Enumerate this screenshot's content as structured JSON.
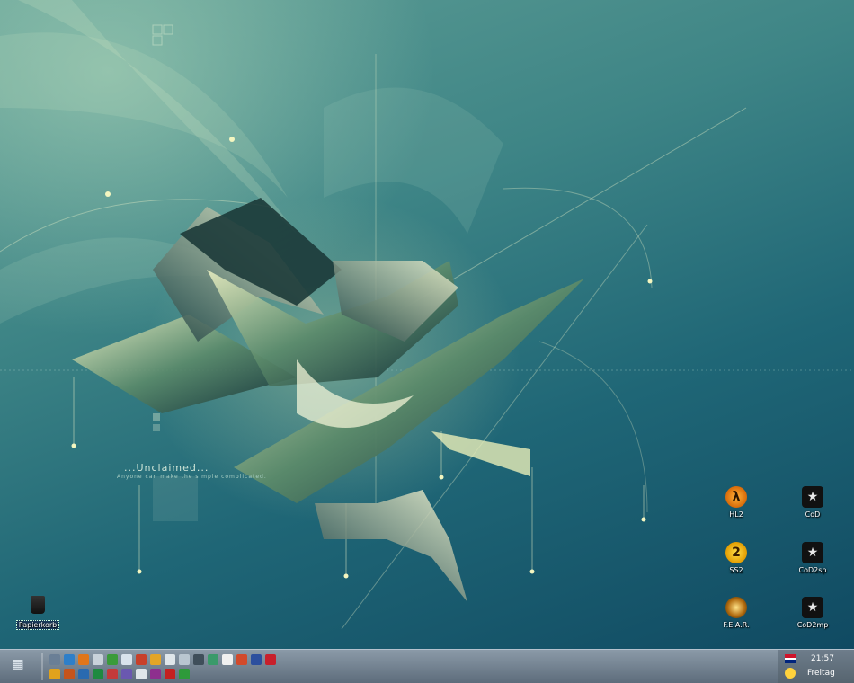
{
  "wallpaper": {
    "title": "...Unclaimed...",
    "subtitle": "Anyone can make the simple complicated."
  },
  "desktop_icons": [
    {
      "id": "hl2",
      "label": "HL2",
      "glyph": "λ",
      "icon": "half-life-2-icon"
    },
    {
      "id": "cod",
      "label": "CoD",
      "glyph": "★",
      "icon": "call-of-duty-icon"
    },
    {
      "id": "ss2",
      "label": "SS2",
      "glyph": "2",
      "icon": "serious-sam-2-icon"
    },
    {
      "id": "cod2sp",
      "label": "CoD2sp",
      "glyph": "★",
      "icon": "call-of-duty-2-sp-icon"
    },
    {
      "id": "fear",
      "label": "F.E.A.R.",
      "glyph": "",
      "icon": "fear-icon"
    },
    {
      "id": "cod2mp",
      "label": "CoD2mp",
      "glyph": "★",
      "icon": "call-of-duty-2-mp-icon"
    },
    {
      "id": "papierkorb",
      "label": "Papierkorb",
      "glyph": "",
      "icon": "recycle-bin-icon"
    }
  ],
  "taskbar": {
    "start_icon": "start-grid-icon",
    "start_glyph": "▦",
    "quicklaunch": [
      {
        "icon": "computer-icon",
        "color": "#6a7f96"
      },
      {
        "icon": "globe-icon",
        "color": "#2e7fc9"
      },
      {
        "icon": "firefox-icon",
        "color": "#e0761b"
      },
      {
        "icon": "eject-icon",
        "color": "#c9d2da"
      },
      {
        "icon": "recycle-icon",
        "color": "#3a9b3a"
      },
      {
        "icon": "document-icon",
        "color": "#d9e3ec"
      },
      {
        "icon": "media-icon",
        "color": "#c8402a"
      },
      {
        "icon": "folder-icon",
        "color": "#e3a526"
      },
      {
        "icon": "cd-icon",
        "color": "#dfe6ea"
      },
      {
        "icon": "window-icon",
        "color": "#b9c6d0"
      },
      {
        "icon": "check-icon",
        "color": "#3f4e5a"
      },
      {
        "icon": "tools-icon",
        "color": "#3a9a6a"
      },
      {
        "icon": "disc-icon",
        "color": "#f0f0f0"
      },
      {
        "icon": "palette-icon",
        "color": "#d24a2c"
      },
      {
        "icon": "save-icon",
        "color": "#2c4f9e"
      },
      {
        "icon": "flag-icon",
        "color": "#c8202c"
      },
      {
        "icon": "pencil-icon",
        "color": "#e0a21c"
      },
      {
        "icon": "paint-icon",
        "color": "#c6541c"
      },
      {
        "icon": "network-icon",
        "color": "#2a6ab0"
      },
      {
        "icon": "game-icon",
        "color": "#1e8a40"
      },
      {
        "icon": "shield-icon",
        "color": "#c43a3a"
      },
      {
        "icon": "player-icon",
        "color": "#6a58b0"
      },
      {
        "icon": "headphones-icon",
        "color": "#dfe6ea"
      },
      {
        "icon": "image-icon",
        "color": "#8e2f8e"
      },
      {
        "icon": "settings-icon",
        "color": "#c42020"
      },
      {
        "icon": "arrow-icon",
        "color": "#2e9a3a"
      }
    ]
  },
  "tray": {
    "language_icon": "uk-flag-icon",
    "status_icon": "smiley-icon",
    "time": "21:57",
    "day": "Freitag"
  }
}
